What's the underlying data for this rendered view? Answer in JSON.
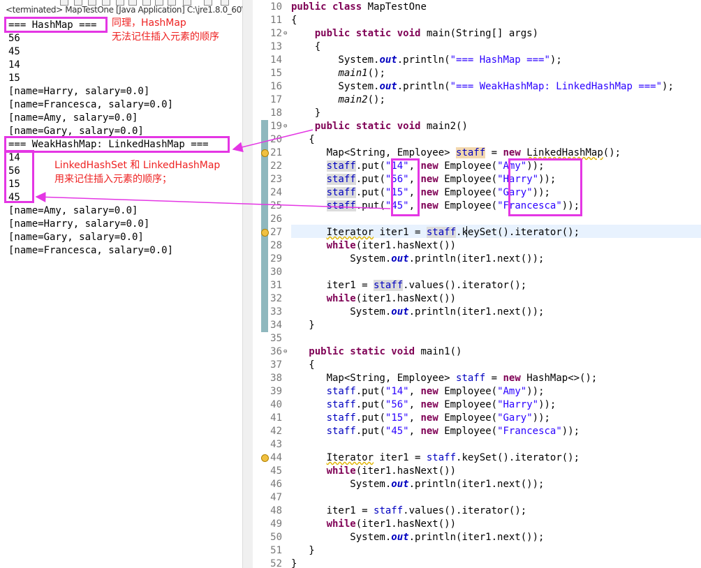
{
  "console": {
    "header": "<terminated> MapTestOne [Java Application] C:\\jre1.8.0_60\\",
    "lines": [
      "=== HashMap ===",
      "56",
      "45",
      "14",
      "15",
      "[name=Harry, salary=0.0]",
      "[name=Francesca, salary=0.0]",
      "[name=Amy, salary=0.0]",
      "[name=Gary, salary=0.0]",
      "=== WeakHashMap: LinkedHashMap ===",
      "14",
      "56",
      "15",
      "45",
      "[name=Amy, salary=0.0]",
      "[name=Harry, salary=0.0]",
      "[name=Gary, salary=0.0]",
      "[name=Francesca, salary=0.0]"
    ]
  },
  "annotations": {
    "hashmap_note_1": "同理，HashMap",
    "hashmap_note_2": "无法记住插入元素的顺序",
    "linked_note_1": "LinkedHashSet 和 LinkedHashMap",
    "linked_note_2": "用来记住插入元素的顺序；",
    "highlight_color": "#e436e4",
    "note_color": "#ee2222"
  },
  "editor": {
    "line_numbers": [
      "10",
      "11",
      "12",
      "13",
      "14",
      "15",
      "16",
      "17",
      "18",
      "19",
      "20",
      "21",
      "22",
      "23",
      "24",
      "25",
      "26",
      "27",
      "28",
      "29",
      "30",
      "31",
      "32",
      "33",
      "34",
      "35",
      "36",
      "37",
      "38",
      "39",
      "40",
      "41",
      "42",
      "43",
      "44",
      "45",
      "46",
      "47",
      "48",
      "49",
      "50",
      "51",
      "52"
    ],
    "fold_markers": {
      "12": "⊖",
      "19": "⊖",
      "36": "⊖"
    },
    "warning_lines": [
      "21",
      "27",
      "44"
    ],
    "colors": {
      "keyword": "#7f0055",
      "string": "#2a00ff",
      "field": "#0000c0",
      "change_bar": "#8fb8be",
      "current_line": "#e8f2fe"
    }
  }
}
